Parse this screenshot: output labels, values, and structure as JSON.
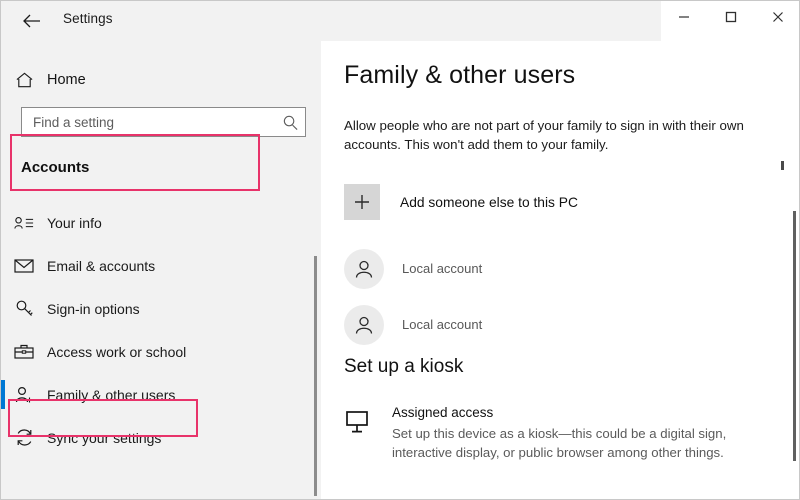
{
  "titlebar": {
    "app_title": "Settings",
    "back_icon": "back-arrow-icon",
    "minimize_label": "─",
    "maximize_label": "☐",
    "close_label": "✕"
  },
  "sidebar": {
    "home_label": "Home",
    "home_icon": "home-icon",
    "search": {
      "placeholder": "Find a setting",
      "value": "",
      "icon": "search-icon"
    },
    "section_label": "Accounts",
    "items": [
      {
        "label": "Your info",
        "icon": "person-list-icon",
        "selected": false
      },
      {
        "label": "Email & accounts",
        "icon": "envelope-icon",
        "selected": false
      },
      {
        "label": "Sign-in options",
        "icon": "key-icon",
        "selected": false
      },
      {
        "label": "Access work or school",
        "icon": "briefcase-icon",
        "selected": false
      },
      {
        "label": "Family & other users",
        "icon": "person-add-icon",
        "selected": true
      },
      {
        "label": "Sync your settings",
        "icon": "sync-icon",
        "selected": false
      }
    ]
  },
  "main": {
    "page_title": "Family & other users",
    "description": "Allow people who are not part of your family to sign in with their own accounts. This won't add them to your family.",
    "add_user": {
      "label": "Add someone else to this PC",
      "icon": "plus-icon"
    },
    "accounts": [
      {
        "name": "",
        "subtitle": "Local account",
        "icon": "user-avatar-icon",
        "redacted": true
      },
      {
        "name": "",
        "subtitle": "Local account",
        "icon": "user-avatar-icon",
        "redacted": true
      }
    ],
    "kiosk": {
      "title": "Set up a kiosk",
      "item_name": "Assigned access",
      "item_icon": "kiosk-display-icon",
      "item_description": "Set up this device as a kiosk—this could be a digital sign, interactive display, or public browser among other things."
    }
  },
  "colors": {
    "annotation": "#e8336a",
    "accent": "#0078d4",
    "sidebar_bg": "#f2f2f2",
    "panel_bg": "#ffffff"
  }
}
